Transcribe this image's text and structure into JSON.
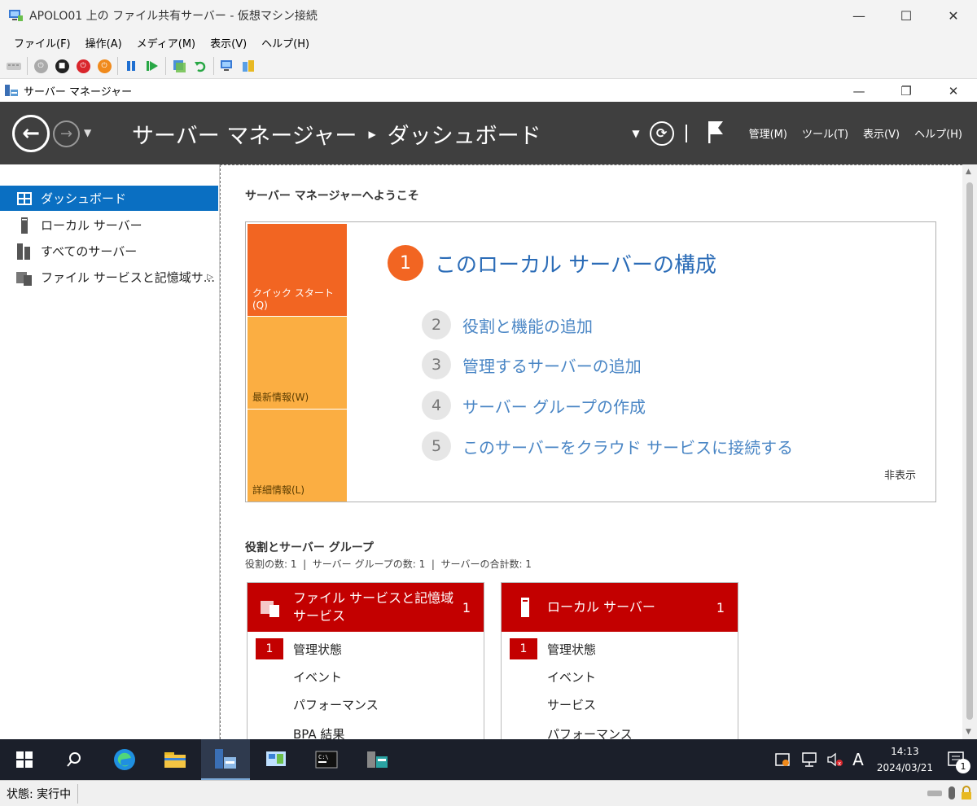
{
  "vm_window": {
    "title": "APOLO01 上の ファイル共有サーバー - 仮想マシン接続",
    "menu": [
      "ファイル(F)",
      "操作(A)",
      "メディア(M)",
      "表示(V)",
      "ヘルプ(H)"
    ]
  },
  "sm_window": {
    "title": "サーバー マネージャー"
  },
  "header": {
    "app_name": "サーバー マネージャー",
    "page_name": "ダッシュボード",
    "menu": [
      "管理(M)",
      "ツール(T)",
      "表示(V)",
      "ヘルプ(H)"
    ]
  },
  "sidebar": {
    "items": [
      {
        "label": "ダッシュボード",
        "icon": "dashboard-icon"
      },
      {
        "label": "ローカル サーバー",
        "icon": "server-icon"
      },
      {
        "label": "すべてのサーバー",
        "icon": "servers-icon"
      },
      {
        "label": "ファイル サービスと記憶域サ...",
        "icon": "file-services-icon"
      }
    ]
  },
  "welcome": {
    "title": "サーバー マネージャーへようこそ",
    "tiles": [
      "クイック スタート(Q)",
      "最新情報(W)",
      "詳細情報(L)"
    ],
    "steps": [
      {
        "num": "1",
        "label": "このローカル サーバーの構成"
      },
      {
        "num": "2",
        "label": "役割と機能の追加"
      },
      {
        "num": "3",
        "label": "管理するサーバーの追加"
      },
      {
        "num": "4",
        "label": "サーバー グループの作成"
      },
      {
        "num": "5",
        "label": "このサーバーをクラウド サービスに接続する"
      }
    ],
    "hide": "非表示"
  },
  "roles": {
    "title": "役割とサーバー グループ",
    "summary": "役割の数: 1  |  サーバー グループの数: 1  |  サーバーの合計数: 1",
    "cards": [
      {
        "title": "ファイル サービスと記憶域 サービス",
        "title_line1": "ファイル サービスと記憶域",
        "title_line2": "サービス",
        "count": "1",
        "rows": [
          {
            "badge": "1",
            "label": "管理状態"
          },
          {
            "badge": "",
            "label": "イベント"
          },
          {
            "badge": "",
            "label": "パフォーマンス"
          },
          {
            "badge": "",
            "label": "BPA 結果"
          }
        ]
      },
      {
        "title": "ローカル サーバー",
        "count": "1",
        "rows": [
          {
            "badge": "1",
            "label": "管理状態"
          },
          {
            "badge": "",
            "label": "イベント"
          },
          {
            "badge": "",
            "label": "サービス"
          },
          {
            "badge": "",
            "label": "パフォーマンス"
          }
        ]
      }
    ]
  },
  "taskbar": {
    "ime": "A",
    "time": "14:13",
    "date": "2024/03/21",
    "notification_count": "1"
  },
  "statusbar": {
    "status": "状態: 実行中"
  },
  "colors": {
    "accent_blue": "#0a6fc2",
    "quickstart_orange": "#f26522",
    "tile_amber": "#fbae42",
    "card_red": "#c30000",
    "header_dark": "#3f3f3f",
    "link_blue": "#2b6cb7"
  }
}
